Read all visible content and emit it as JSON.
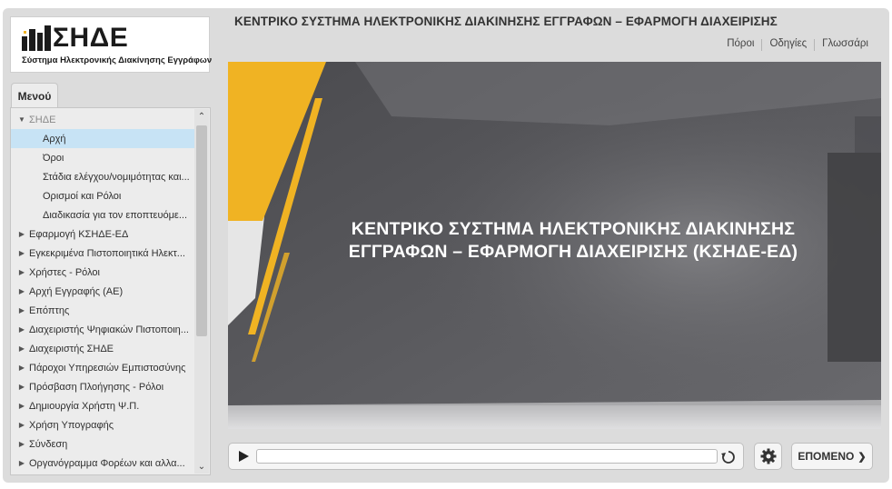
{
  "header": {
    "logo_text": "ΣΗΔΕ",
    "logo_subtitle": "Σύστημα Ηλεκτρονικής Διακίνησης Εγγράφων",
    "app_title": "ΚΕΝΤΡΙΚΟ ΣΥΣΤΗΜΑ ΗΛΕΚΤΡΟΝΙΚΗΣ ΔΙΑΚΙΝΗΣΗΣ ΕΓΓΡΑΦΩΝ – ΕΦΑΡΜΟΓΗ ΔΙΑΧΕΙΡΙΣΗΣ",
    "links": [
      "Πόροι",
      "Οδηγίες",
      "Γλωσσάρι"
    ]
  },
  "sidebar": {
    "tab_label": "Μενού",
    "section_label": "ΣΗΔΕ",
    "sub_items": [
      "Αρχή",
      "Όροι",
      "Στάδια ελέγχου/νομιμότητας και...",
      "Ορισμοί και Ρόλοι",
      "Διαδικασία για τον εποπτευόμε..."
    ],
    "items": [
      "Εφαρμογή ΚΣΗΔΕ-ΕΔ",
      "Εγκεκριμένα Πιστοποιητικά Ηλεκτ...",
      "Χρήστες - Ρόλοι",
      "Αρχή Εγγραφής (ΑΕ)",
      "Επόπτης",
      "Διαχειριστής Ψηφιακών Πιστοποιη...",
      "Διαχειριστής ΣΗΔΕ",
      "Πάροχοι Υπηρεσιών Εμπιστοσύνης",
      "Πρόσβαση Πλοήγησης - Ρόλοι",
      "Δημιουργία Χρήστη Ψ.Π.",
      "Χρήση Υπογραφής",
      "Σύνδεση",
      "Οργανόγραμμα Φορέων και αλλα..."
    ]
  },
  "slide": {
    "title_line1": "ΚΕΝΤΡΙΚΟ ΣΥΣΤΗΜΑ ΗΛΕΚΤΡΟΝΙΚΗΣ ΔΙΑΚΙΝΗΣΗΣ",
    "title_line2": "ΕΓΓΡΑΦΩΝ – ΕΦΑΡΜΟΓΗ ΔΙΑΧΕΙΡΙΣΗΣ (ΚΣΗΔΕ-ΕΔ)"
  },
  "controls": {
    "next_label": "ΕΠΟΜΕΝΟ",
    "progress": 0
  },
  "colors": {
    "accent_yellow": "#f0b323",
    "slide_gray": "#5b5b5f",
    "selected_bg": "#c7e3f5"
  }
}
